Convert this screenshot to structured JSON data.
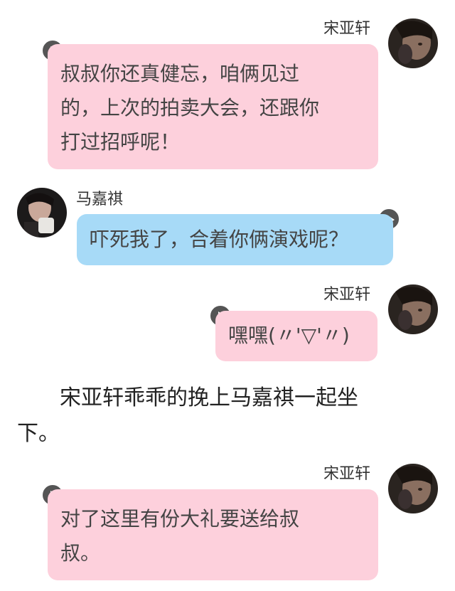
{
  "messages": [
    {
      "sender": "宋亚轩",
      "side": "right",
      "color": "#fdd0dc",
      "lines": [
        "叔叔你还真健忘，咱俩见过",
        "的，上次的拍卖大会，还跟你",
        "打过招呼呢！"
      ]
    },
    {
      "sender": "马嘉祺",
      "side": "left",
      "color": "#a7daf7",
      "lines": [
        "吓死我了，合着你俩演戏呢？"
      ]
    },
    {
      "sender": "宋亚轩",
      "side": "right",
      "color": "#fdd0dc",
      "lines": [
        "嘿嘿(〃'▽'〃)"
      ]
    },
    {
      "sender": "宋亚轩",
      "side": "right",
      "color": "#fdd0dc",
      "lines": [
        "对了这里有份大礼要送给叔",
        "叔。"
      ]
    }
  ],
  "narration": {
    "lines": [
      "　　宋亚轩乖乖的挽上马嘉祺一起坐",
      "下。"
    ]
  },
  "icons": {
    "play": "play-icon",
    "avatar_song": "avatar-photo",
    "avatar_ma": "avatar-photo"
  }
}
